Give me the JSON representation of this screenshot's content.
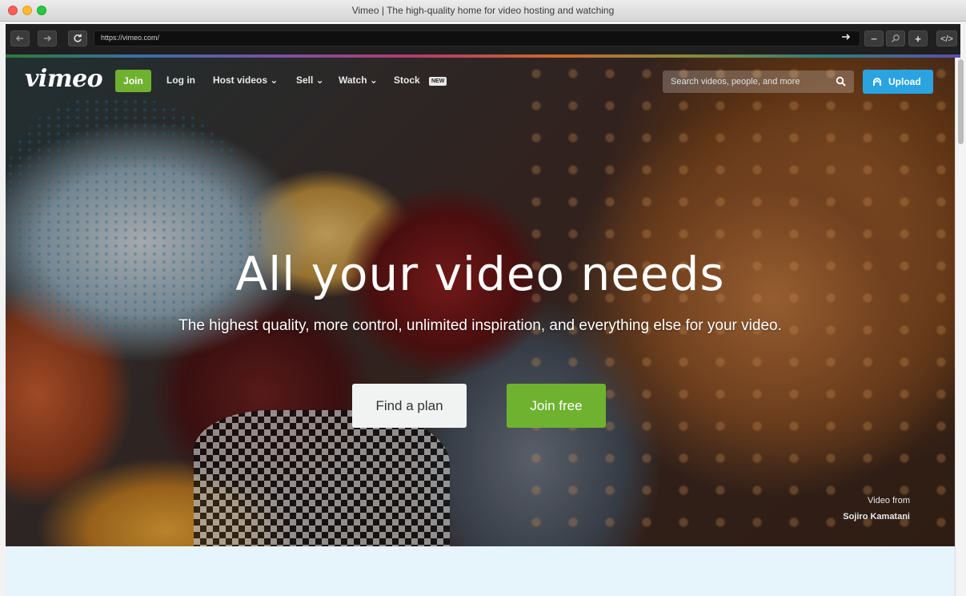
{
  "window": {
    "title": "Vimeo | The high-quality home for video hosting and watching"
  },
  "toolbar": {
    "back_icon": "arrow-left-icon",
    "forward_icon": "arrow-right-icon",
    "reload_icon": "reload-icon",
    "url": "https://vimeo.com/",
    "go_icon": "arrow-right-icon",
    "zoom_out": "−",
    "zoom_reset_icon": "magnifier-icon",
    "zoom_in": "+",
    "devtools": "</>"
  },
  "nav": {
    "logo": "vimeo",
    "join": "Join",
    "links": {
      "login": "Log in",
      "host_videos": "Host videos ⌄",
      "sell": "Sell ⌄",
      "watch": "Watch ⌄",
      "stock": "Stock"
    },
    "new_badge": "NEW",
    "search_placeholder": "Search videos, people, and more",
    "upload": "Upload"
  },
  "hero": {
    "headline": "All your video needs",
    "subline": "The highest quality, more control, unlimited inspiration, and everything else for your video.",
    "find_plan": "Find a plan",
    "join_free": "Join free",
    "credit_line1": "Video from",
    "credit_line2": "Sojiro Kamatani"
  },
  "colors": {
    "brand_green": "#6fb230",
    "upload_blue": "#2aa3e1",
    "below_hero": "#e6f4fb"
  }
}
